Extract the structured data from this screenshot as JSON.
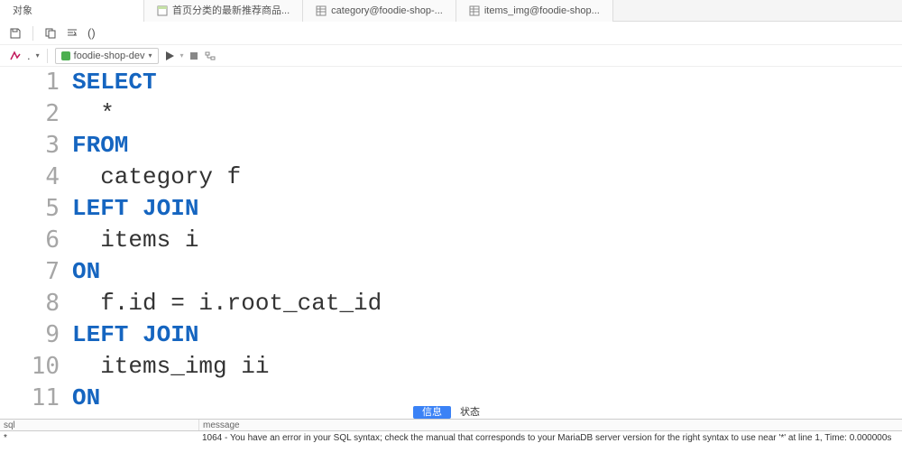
{
  "tabs": {
    "objects": "对象",
    "query": "首页分类的最新推荐商品...",
    "table1": "category@foodie-shop-...",
    "table2": "items_img@foodie-shop..."
  },
  "toolbar1": {
    "parentheses": "()"
  },
  "toolbar2": {
    "format_dot": ".",
    "connection": "foodie-shop-dev"
  },
  "editor": {
    "lines": [
      {
        "n": "1",
        "tokens": [
          {
            "t": "SELECT",
            "k": true
          }
        ]
      },
      {
        "n": "2",
        "tokens": [
          {
            "t": "  *",
            "k": false
          }
        ]
      },
      {
        "n": "3",
        "tokens": [
          {
            "t": "FROM",
            "k": true
          }
        ]
      },
      {
        "n": "4",
        "tokens": [
          {
            "t": "  category f",
            "k": false
          }
        ]
      },
      {
        "n": "5",
        "tokens": [
          {
            "t": "LEFT JOIN",
            "k": true
          }
        ]
      },
      {
        "n": "6",
        "tokens": [
          {
            "t": "  items i",
            "k": false
          }
        ]
      },
      {
        "n": "7",
        "tokens": [
          {
            "t": "ON",
            "k": true
          }
        ]
      },
      {
        "n": "8",
        "tokens": [
          {
            "t": "  f.id = i.root_cat_id",
            "k": false
          }
        ]
      },
      {
        "n": "9",
        "tokens": [
          {
            "t": "LEFT JOIN",
            "k": true
          }
        ]
      },
      {
        "n": "10",
        "tokens": [
          {
            "t": "  items_img ii",
            "k": false
          }
        ]
      },
      {
        "n": "11",
        "tokens": [
          {
            "t": "ON",
            "k": true
          }
        ]
      }
    ]
  },
  "bottom_tabs": {
    "info": "信息",
    "status": "状态"
  },
  "result": {
    "header_sql": "sql",
    "header_message": "message",
    "row_sql": "*",
    "row_message": "1064 - You have an error in your SQL syntax; check the manual that corresponds to your MariaDB server version for the right syntax to use near '*' at line 1, Time: 0.000000s"
  }
}
